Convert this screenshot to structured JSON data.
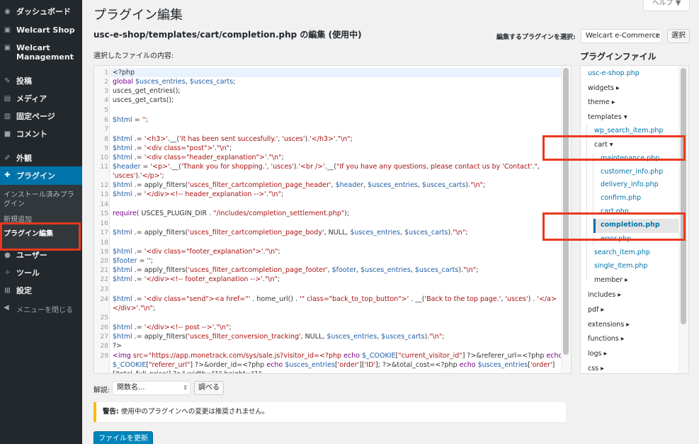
{
  "sidebar": {
    "items": [
      {
        "label": "ダッシュボード",
        "icon": "dashboard-icon"
      },
      {
        "label": "Welcart Shop",
        "icon": "cart-icon"
      },
      {
        "label": "Welcart\nManagement",
        "icon": "cart-icon"
      },
      {
        "label": "投稿",
        "icon": "pin-icon"
      },
      {
        "label": "メディア",
        "icon": "media-icon"
      },
      {
        "label": "固定ページ",
        "icon": "page-icon"
      },
      {
        "label": "コメント",
        "icon": "comment-icon"
      },
      {
        "label": "外観",
        "icon": "brush-icon"
      },
      {
        "label": "プラグイン",
        "icon": "plugin-icon"
      },
      {
        "label": "ユーザー",
        "icon": "users-icon"
      },
      {
        "label": "ツール",
        "icon": "wrench-icon"
      },
      {
        "label": "設定",
        "icon": "settings-icon"
      }
    ],
    "submenu": [
      "インストール済みプラグイン",
      "新規追加",
      "プラグイン編集"
    ],
    "collapse_label": "メニューを閉じる"
  },
  "header": {
    "help_label": "ヘルプ ▼",
    "page_title": "プラグイン編集",
    "file_heading": "usc-e-shop/templates/cart/completion.php の編集 (使用中)",
    "content_label": "選択したファイルの内容:",
    "select_label": "編集するプラグインを選択:",
    "selected_plugin": "Welcart e-Commerce",
    "select_button": "選択"
  },
  "editor": {
    "line_numbers": [
      "1",
      "2",
      "3",
      "4",
      "5",
      "6",
      "7",
      "8",
      "9",
      "10",
      "11",
      "",
      "12",
      "13",
      "14",
      "15",
      "16",
      "17",
      "18",
      "19",
      "20",
      "21",
      "22",
      "23",
      "24",
      "",
      "25",
      "26",
      "27",
      "28",
      "29",
      "",
      ""
    ],
    "highlight_color": "#e8f2fe"
  },
  "files": {
    "title": "プラグインファイル",
    "items": [
      "usc-e-shop.php",
      "widgets ▸",
      "theme ▸",
      "templates ▾",
      "wp_search_item.php",
      "cart ▾",
      "maintenance.php",
      "customer_info.php",
      "delivery_info.php",
      "confirm.php",
      "cart.php",
      "completion.php",
      "error.php",
      "search_item.php",
      "single_item.php",
      "member ▸",
      "includes ▸",
      "pdf ▸",
      "extensions ▸",
      "functions ▸",
      "logs ▸",
      "css ▸"
    ]
  },
  "footer": {
    "doc_label": "解説:",
    "doc_select": "関数名...",
    "doc_button": "調べる",
    "notice_strong": "警告:",
    "notice_text": " 使用中のプラグインへの変更は推奨されません。",
    "update_button": "ファイルを更新"
  },
  "colors": {
    "accent": "#0073aa",
    "highlight_border": "#e8391e",
    "warning": "#ffb900"
  }
}
